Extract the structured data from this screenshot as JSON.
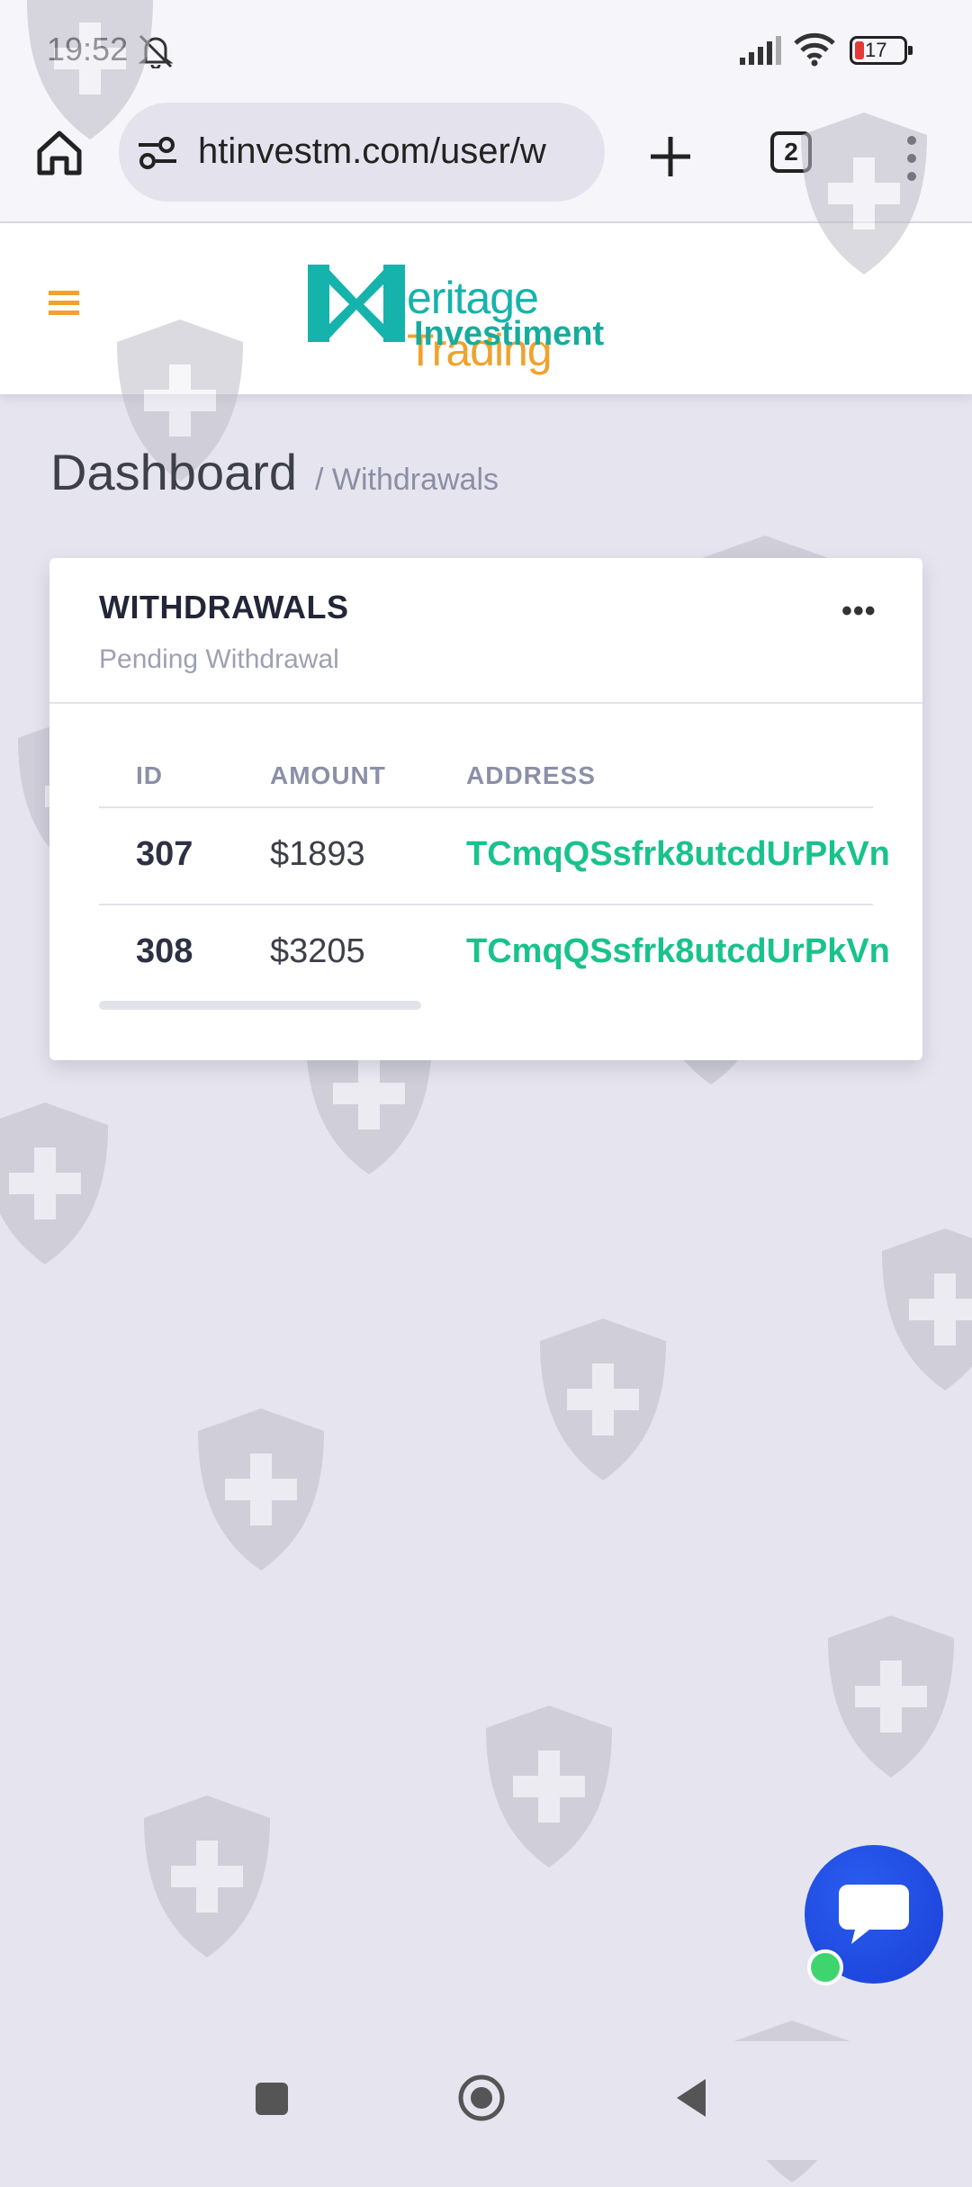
{
  "status_bar": {
    "time": "19:52",
    "battery": "17",
    "icons": [
      "bell-muted-icon",
      "signal-icon",
      "wifi-icon",
      "battery-icon"
    ]
  },
  "browser": {
    "url": "htinvestm.com/user/w",
    "tab_count": "2",
    "icons": [
      "home-icon",
      "site-settings-icon",
      "new-tab-icon",
      "more-icon"
    ]
  },
  "header": {
    "logo_part1": "eritage",
    "logo_part2": "Trading",
    "logo_line2": "Investiment",
    "accent_teal": "#16b3ac",
    "accent_orange": "#f0a22e"
  },
  "breadcrumb": {
    "title": "Dashboard",
    "current": "/ Withdrawals"
  },
  "card": {
    "title": "WITHDRAWALS",
    "subtitle": "Pending Withdrawal",
    "menu_label": "•••",
    "columns": [
      "ID",
      "AMOUNT",
      "ADDRESS"
    ],
    "rows": [
      {
        "id": "307",
        "amount": "$1893",
        "address": "TCmqQSsfrk8utcdUrPkVn"
      },
      {
        "id": "308",
        "amount": "$3205",
        "address": "TCmqQSsfrk8utcdUrPkVn"
      }
    ],
    "address_color": "#19c28c"
  },
  "chat": {
    "online": true,
    "button_color": "#2d57e8"
  },
  "nav": {
    "icons": [
      "recents-icon",
      "home-circle-icon",
      "back-icon"
    ]
  }
}
